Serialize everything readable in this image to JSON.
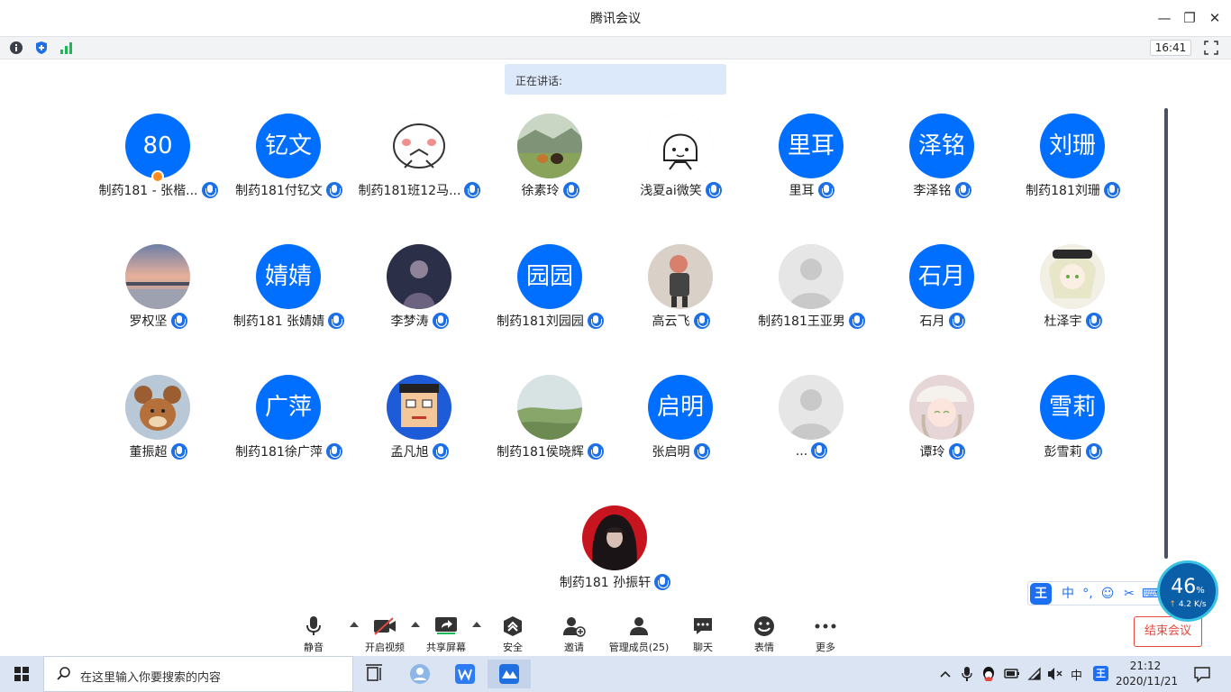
{
  "window": {
    "title": "腾讯会议",
    "minimize": "—",
    "restore": "❐",
    "close": "✕"
  },
  "infobar": {
    "timer": "16:41"
  },
  "speaking_label": "正在讲话:",
  "participants": [
    {
      "name": "制药181 - 张楷...",
      "avatar_text": "80",
      "avatar": "text",
      "host": true
    },
    {
      "name": "制药181付钇文",
      "avatar_text": "钇文",
      "avatar": "text"
    },
    {
      "name": "制药181班12马...",
      "avatar": "cartoon-face"
    },
    {
      "name": "徐素玲",
      "avatar": "landscape-dogs"
    },
    {
      "name": "浅夏ai微笑",
      "avatar": "sketch-girl"
    },
    {
      "name": "里耳",
      "avatar_text": "里耳",
      "avatar": "text"
    },
    {
      "name": "李泽铭",
      "avatar_text": "泽铭",
      "avatar": "text"
    },
    {
      "name": "制药181刘珊",
      "avatar_text": "刘珊",
      "avatar": "text"
    },
    {
      "name": "罗权坚",
      "avatar": "sunset"
    },
    {
      "name": "制药181 张婧婧",
      "avatar_text": "婧婧",
      "avatar": "text"
    },
    {
      "name": "李梦涛",
      "avatar": "dark-figure"
    },
    {
      "name": "制药181刘园园",
      "avatar_text": "园园",
      "avatar": "text"
    },
    {
      "name": "高云飞",
      "avatar": "child-photo"
    },
    {
      "name": "制药181王亚男",
      "avatar": "default"
    },
    {
      "name": "石月",
      "avatar_text": "石月",
      "avatar": "text"
    },
    {
      "name": "杜泽宇",
      "avatar": "anime-girl"
    },
    {
      "name": "董振超",
      "avatar": "cartoon-mouse"
    },
    {
      "name": "制药181徐广萍",
      "avatar_text": "广萍",
      "avatar": "text"
    },
    {
      "name": "孟凡旭",
      "avatar": "pixel-face"
    },
    {
      "name": "制药181侯晓辉",
      "avatar": "green-hills"
    },
    {
      "name": "张启明",
      "avatar_text": "启明",
      "avatar": "text"
    },
    {
      "name": "...",
      "avatar": "default"
    },
    {
      "name": "谭玲",
      "avatar": "anime-hat"
    },
    {
      "name": "彭雪莉",
      "avatar_text": "雪莉",
      "avatar": "text"
    },
    {
      "name": "制药181 孙振轩",
      "avatar": "hooded-figure"
    }
  ],
  "toolbar": {
    "mute": "静音",
    "video": "开启视频",
    "share": "共享屏幕",
    "security": "安全",
    "invite": "邀请",
    "members": "管理成员(25)",
    "chat": "聊天",
    "emoji": "表情",
    "more": "更多",
    "end": "结束会议"
  },
  "ime": {
    "logo": "王",
    "lang": "中",
    "punct": "°,",
    "emoji": "☺",
    "cut": "✂",
    "keyboard": "⌨"
  },
  "net_gauge": {
    "percent": "46",
    "percent_sign": "%",
    "speed": "4.2 K/s"
  },
  "taskbar": {
    "search_placeholder": "在这里输入你要搜索的内容",
    "ime_lang": "中",
    "ime_logo": "王",
    "time": "21:12",
    "date": "2020/11/21"
  },
  "colors": {
    "accent": "#006fff",
    "end_red": "#e5483e"
  }
}
